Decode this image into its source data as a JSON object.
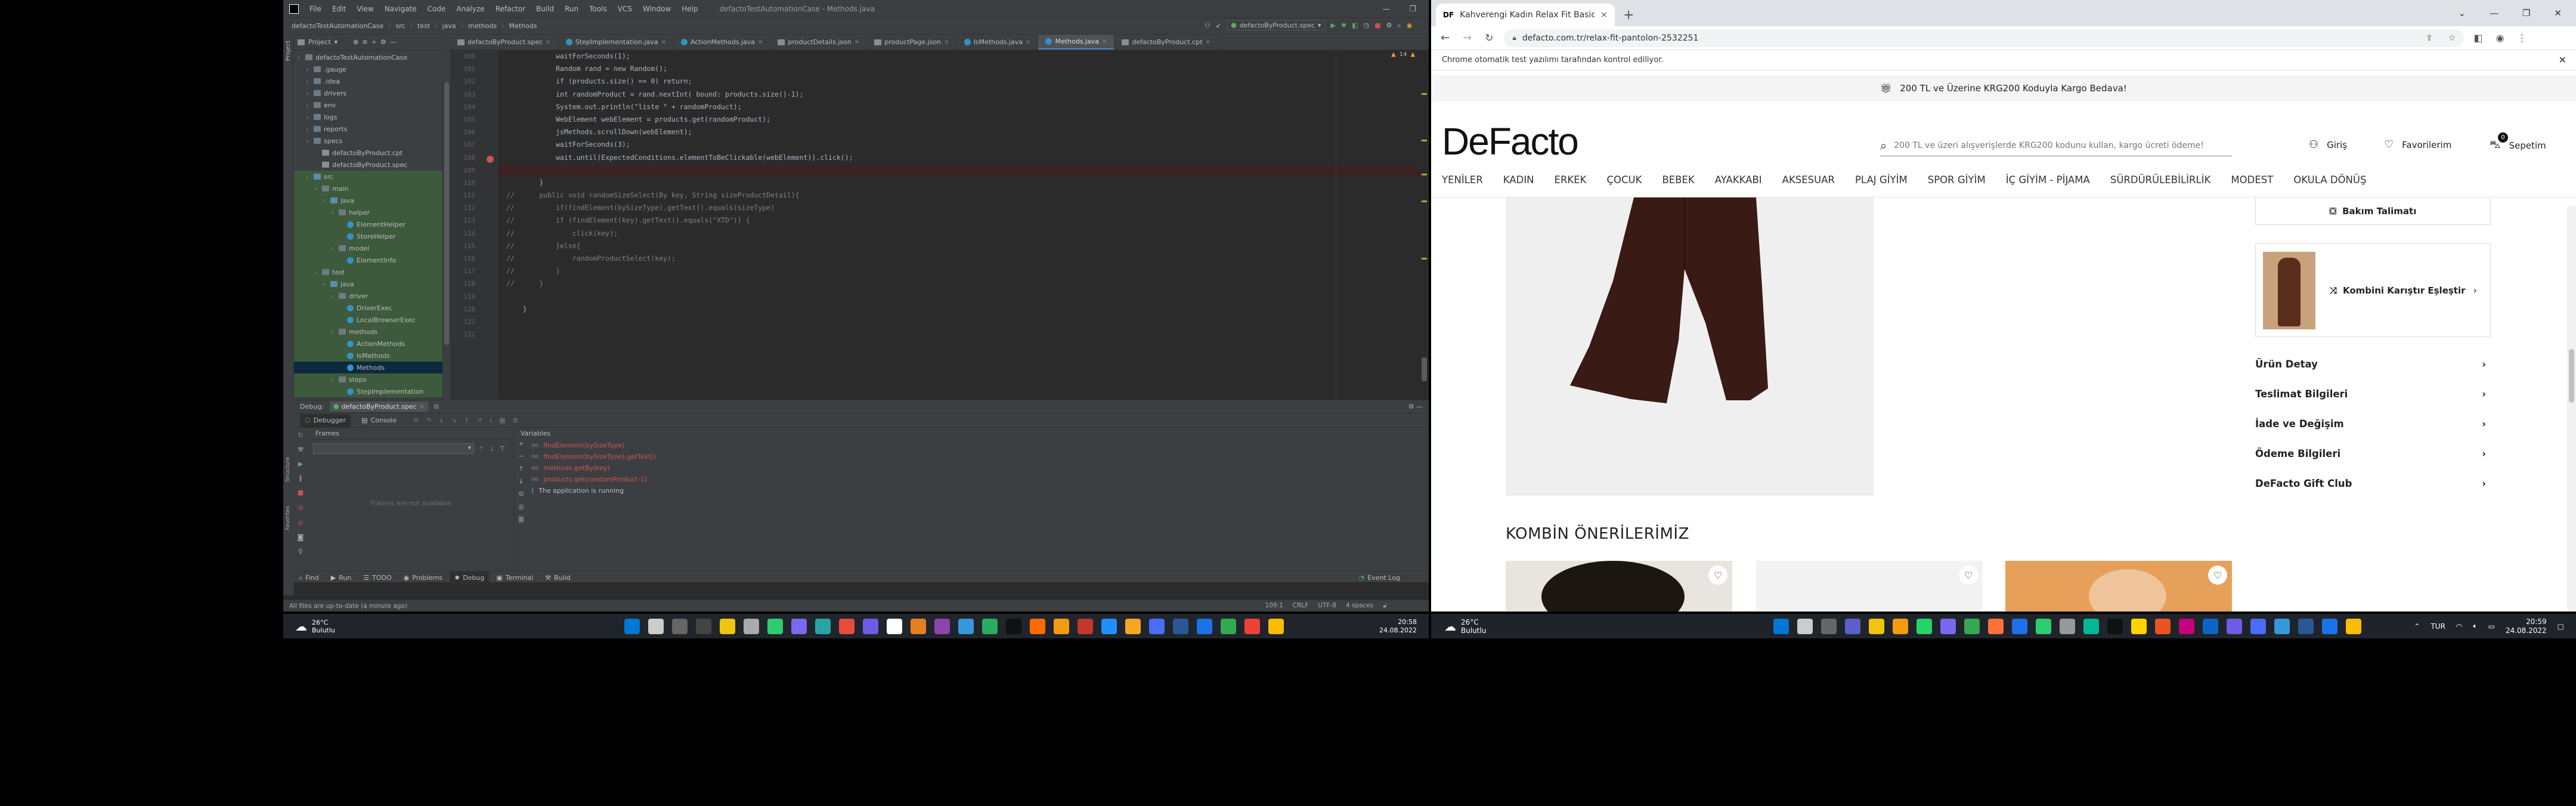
{
  "ide": {
    "menu": [
      "File",
      "Edit",
      "View",
      "Navigate",
      "Code",
      "Analyze",
      "Refactor",
      "Build",
      "Run",
      "Tools",
      "VCS",
      "Window",
      "Help"
    ],
    "window_title": "defactoTestAutomationCase - Methods.java",
    "breadcrumbs": [
      "defactoTestAutomationCase",
      "src",
      "test",
      "java",
      "methods",
      "Methods"
    ],
    "run_config": "defactoByProduct.spec",
    "tabs": [
      {
        "label": "defactoByProduct.spec",
        "active": false
      },
      {
        "label": "StepImplementation.java",
        "active": false
      },
      {
        "label": "ActionMethods.java",
        "active": false
      },
      {
        "label": "productDetails.json",
        "active": false
      },
      {
        "label": "productPage.json",
        "active": false
      },
      {
        "label": "IsMethods.java",
        "active": false
      },
      {
        "label": "Methods.java",
        "active": true
      },
      {
        "label": "defactoByProduct.cpt",
        "active": false
      }
    ],
    "project": {
      "header": "Project",
      "rows": [
        {
          "label": "defactoTestAutomationCase",
          "depth": 0,
          "kind": "pkg"
        },
        {
          "label": ".gauge",
          "depth": 1,
          "kind": "pkg"
        },
        {
          "label": ".idea",
          "depth": 1,
          "kind": "pkg"
        },
        {
          "label": "drivers",
          "depth": 1,
          "kind": "pkg"
        },
        {
          "label": "env",
          "depth": 1,
          "kind": "pkg"
        },
        {
          "label": "logs",
          "depth": 1,
          "kind": "pkg"
        },
        {
          "label": "reports",
          "depth": 1,
          "kind": "pkg"
        },
        {
          "label": "specs",
          "depth": 1,
          "kind": "pkg"
        },
        {
          "label": "defactoByProduct.cpt",
          "depth": 2,
          "kind": "file"
        },
        {
          "label": "defactoByProduct.spec",
          "depth": 2,
          "kind": "file"
        },
        {
          "label": "src",
          "depth": 1,
          "kind": "src"
        },
        {
          "label": "main",
          "depth": 2,
          "kind": "pkg"
        },
        {
          "label": "java",
          "depth": 3,
          "kind": "src"
        },
        {
          "label": "helper",
          "depth": 4,
          "kind": "pkg"
        },
        {
          "label": "ElementHelper",
          "depth": 5,
          "kind": "class"
        },
        {
          "label": "StoreHelper",
          "depth": 5,
          "kind": "class"
        },
        {
          "label": "model",
          "depth": 4,
          "kind": "pkg"
        },
        {
          "label": "ElementInfo",
          "depth": 5,
          "kind": "class"
        },
        {
          "label": "test",
          "depth": 2,
          "kind": "pkg"
        },
        {
          "label": "java",
          "depth": 3,
          "kind": "src"
        },
        {
          "label": "driver",
          "depth": 4,
          "kind": "pkg"
        },
        {
          "label": "DriverExec",
          "depth": 5,
          "kind": "class"
        },
        {
          "label": "LocalBrowserExec",
          "depth": 5,
          "kind": "class"
        },
        {
          "label": "methods",
          "depth": 4,
          "kind": "pkg"
        },
        {
          "label": "ActionMethods",
          "depth": 5,
          "kind": "class"
        },
        {
          "label": "IsMethods",
          "depth": 5,
          "kind": "class"
        },
        {
          "label": "Methods",
          "depth": 5,
          "kind": "class"
        },
        {
          "label": "steps",
          "depth": 4,
          "kind": "pkg"
        },
        {
          "label": "StepImplementation",
          "depth": 5,
          "kind": "class"
        }
      ]
    },
    "line_numbers": [
      "100",
      "101",
      "102",
      "103",
      "104",
      "105",
      "106",
      "107",
      "108",
      "109",
      "110",
      "111",
      "112",
      "113",
      "114",
      "115",
      "116",
      "117",
      "118",
      "119",
      "120",
      "121",
      "122"
    ],
    "code_lines": [
      "            waitForSeconds(1);",
      "            Random rand = new Random();",
      "            if (products.size() == 0) return;",
      "            int randomProduct = rand.nextInt( bound: products.size()-1);",
      "            System.out.println(\"liste \" + randomProduct);",
      "            WebElement webElement = products.get(randomProduct);",
      "            jsMethods.scrollDown(webElement);",
      "            waitForSeconds(3);",
      "            wait.until(ExpectedConditions.elementToBeClickable(webElement)).click();",
      "",
      "        }",
      "//      public void randomSizeSelect(By key, String sizeProductDetail){",
      "//          if(findElement(bySizeType).getText().equals(sizeType)",
      "//          if (findElement(key).getText().equals(\"XTD\")) {",
      "//              click(key);",
      "//          }else{",
      "//              randomProductSelect(key);",
      "//          }",
      "//      }",
      "",
      "    }",
      "",
      ""
    ],
    "breakpoint_line": "109",
    "inspection": {
      "warnings": "14",
      "weak": "22"
    },
    "debug": {
      "label": "Debug:",
      "config_tab": "defactoByProduct.spec",
      "tabs": [
        "Debugger",
        "Console"
      ],
      "frames_label": "Frames",
      "variables_label": "Variables",
      "frames_empty": "Frames are not available",
      "variables": [
        "findElement(bySizeType)",
        "findElement(bySizeType).getText()",
        "methods.getBy(key)",
        "products.get(randomProduct-1)"
      ],
      "running_note": "The application is running"
    },
    "bottom_tools": [
      "Find",
      "Run",
      "TODO",
      "Problems",
      "Debug",
      "Terminal",
      "Build"
    ],
    "event_log": "Event Log",
    "status_left": "All files are up-to-date (a minute ago)",
    "status_right": [
      "109:1",
      "CRLF",
      "UTF-8",
      "4 spaces"
    ]
  },
  "browser": {
    "tab_title": "Kahverengi Kadın Relax Fit Basic",
    "url": "defacto.com.tr/relax-fit-pantolon-2532251",
    "automation_notice": "Chrome otomatik test yazılımı tarafından kontrol ediliyor.",
    "promo": "200 TL ve Üzerine KRG200 Koduyla Kargo Bedava!",
    "logo": "DeFacto",
    "search_placeholder": "200 TL ve üzeri alışverişlerde KRG200 kodunu kullan, kargo ücreti ödeme!",
    "login": "Giriş",
    "favorites": "Favorilerim",
    "cart": "Sepetim",
    "cart_count": "0",
    "categories": [
      "YENİLER",
      "KADIN",
      "ERKEK",
      "ÇOCUK",
      "BEBEK",
      "AYAKKABI",
      "AKSESUAR",
      "PLAJ GİYİM",
      "SPOR GİYİM",
      "İÇ GİYİM - PİJAMA",
      "SÜRDÜRÜLEBİLİRLİK",
      "MODEST",
      "OKULA DÖNÜŞ"
    ],
    "care_button": "Bakım Talimatı",
    "combine_button": "Kombini Karıştır Eşleştir",
    "accordion": [
      "Ürün Detay",
      "Teslimat Bilgileri",
      "İade ve Değişim",
      "Ödeme Bilgileri",
      "DeFacto Gift Club"
    ],
    "recommendations_title": "KOMBİN ÖNERİLERİMİZ"
  },
  "taskbar_left": {
    "temp": "26°C",
    "weather": "Bulutlu",
    "time": "20:58",
    "date": "24.08.2022"
  },
  "taskbar_right": {
    "temp": "26°C",
    "weather": "Bulutlu",
    "lang": "TUR",
    "time": "20:59",
    "date": "24.08.2022"
  },
  "colors": {
    "ide_bg": "#2b2b2b",
    "ide_panel": "#3c3f41",
    "accent": "#4a88c7",
    "keyword": "#cc7832",
    "string": "#6a8759",
    "breakpoint": "#c75450",
    "browser_accent": "#222222"
  }
}
